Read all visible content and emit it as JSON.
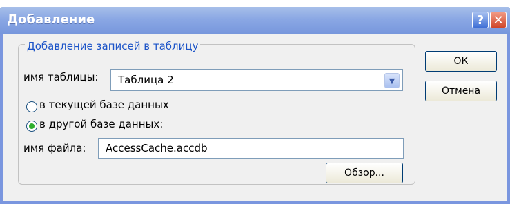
{
  "window": {
    "title": "Добавление"
  },
  "title_buttons": {
    "help": "?",
    "close": "✕"
  },
  "group": {
    "title": "Добавление записей в таблицу"
  },
  "table_name": {
    "label": "имя таблицы:",
    "value": "Таблица 2"
  },
  "destination": {
    "options": [
      {
        "label": "в текущей базе данных",
        "selected": false
      },
      {
        "label": "в другой базе данных:",
        "selected": true
      }
    ]
  },
  "file_name": {
    "label": "имя файла:",
    "value": "AccessCache.accdb"
  },
  "buttons": {
    "browse": "Обзор...",
    "ok": "ОК",
    "cancel": "Отмена"
  }
}
